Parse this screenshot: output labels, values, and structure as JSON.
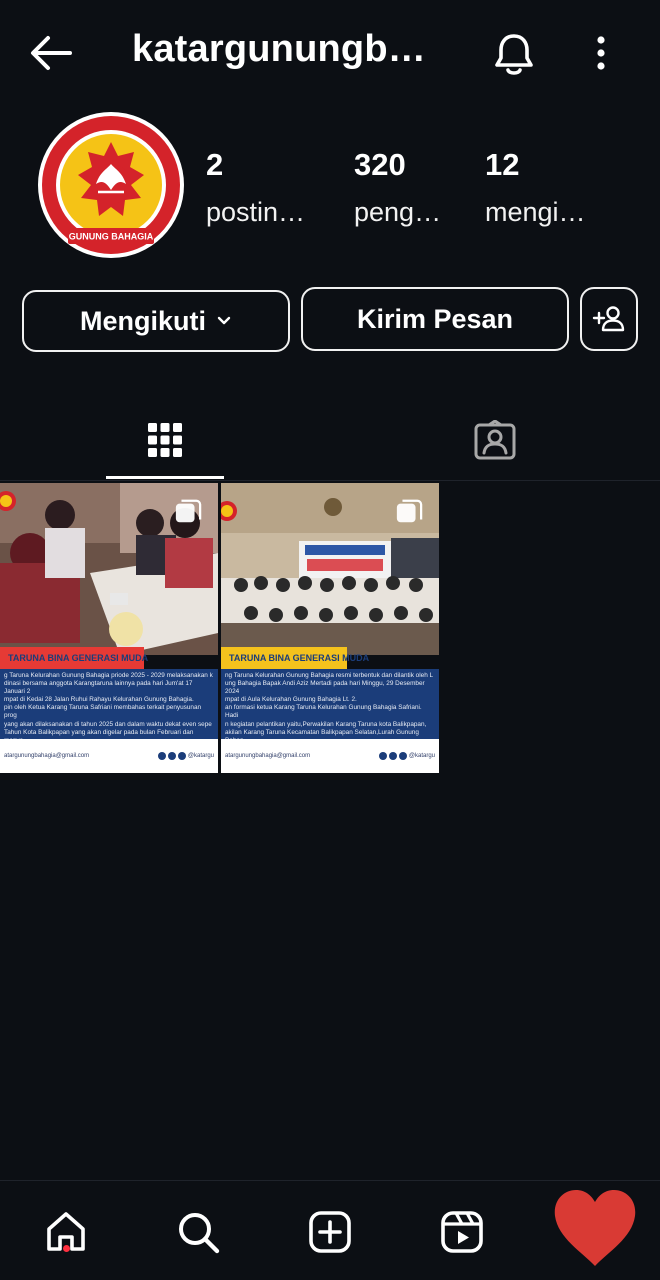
{
  "header": {
    "title": "katargunungb…",
    "icons": [
      "back-arrow-icon",
      "bell-icon",
      "more-vertical-icon"
    ]
  },
  "profile": {
    "avatar_text": "GUNUNG BAHAGIA",
    "stats": [
      {
        "value": "2",
        "label": "postin…"
      },
      {
        "value": "320",
        "label": "peng…"
      },
      {
        "value": "12",
        "label": "mengi…"
      }
    ]
  },
  "actions": {
    "following_label": "Mengikuti",
    "message_label": "Kirim Pesan"
  },
  "tabs": {
    "active": "grid",
    "items": [
      "grid-icon",
      "tagged-icon"
    ]
  },
  "posts": [
    {
      "banner": "TARUNA BINA GENERASI MUDA",
      "banner_color": "#e63a35",
      "caption": "g Taruna Kelurahan Gunung Bahagia priode 2025 - 2029 melaksanakan k\ndinasi bersama anggota Karangtaruna lainnya pada hari Jum'at 17 Januari 2\nmpat di Kedai 28 Jalan Ruhui Rahayu Kelurahan Gunung Bahagia.\npin oleh Ketua Karang Taruna Safriani membahas terkait penyusunan prog\nyang akan dilaksanakan di tahun 2025 dan dalam waktu dekat even sepe\nTahun Kota Balikpapan yang akan digelar pada bulan Februari dan menye\ndhan yang waktunya sebentar lagi datang.",
      "email": "atargunungbahagia@gmail.com",
      "handle": "@katargu"
    },
    {
      "banner": "TARUNA BINA GENERASI MUDA",
      "banner_color": "#f4c21d",
      "caption": "ng Taruna Kelurahan Gunung Bahagia resmi terbentuk dan dilantik oleh L\nung Bahagia Bapak Andi Aziz Mertadi pada hari Minggu, 29 Desember 2024\nmpat di Aula Kelurahan Gunung Bahagia Lt. 2.\nan formasi ketua Karang Taruna Kelurahan Gunung Bahagia Safriani. Hadi\nn kegiatan pelantikan yaitu,Perwakilan Karang Taruna kota Balikpapan,\nakilan Karang Taruna Kecamatan Balikpapan Selatan,Lurah Gunung Bahag\netaris Lurah, Babinsa dan Babinkamtibmas Kelurahan Gunung Bahagia, Ket\nGunung Bahagia serta Ketua RT se-Kelurahan Gunung Bahagia.",
      "email": "atargunungbahagia@gmail.com",
      "handle": "@katargu"
    }
  ],
  "bottom_nav": {
    "items": [
      "home-icon",
      "search-icon",
      "create-icon",
      "reels-icon",
      "heart-icon"
    ],
    "heart_color": "#d93a34",
    "notification_color": "#ff3040"
  }
}
